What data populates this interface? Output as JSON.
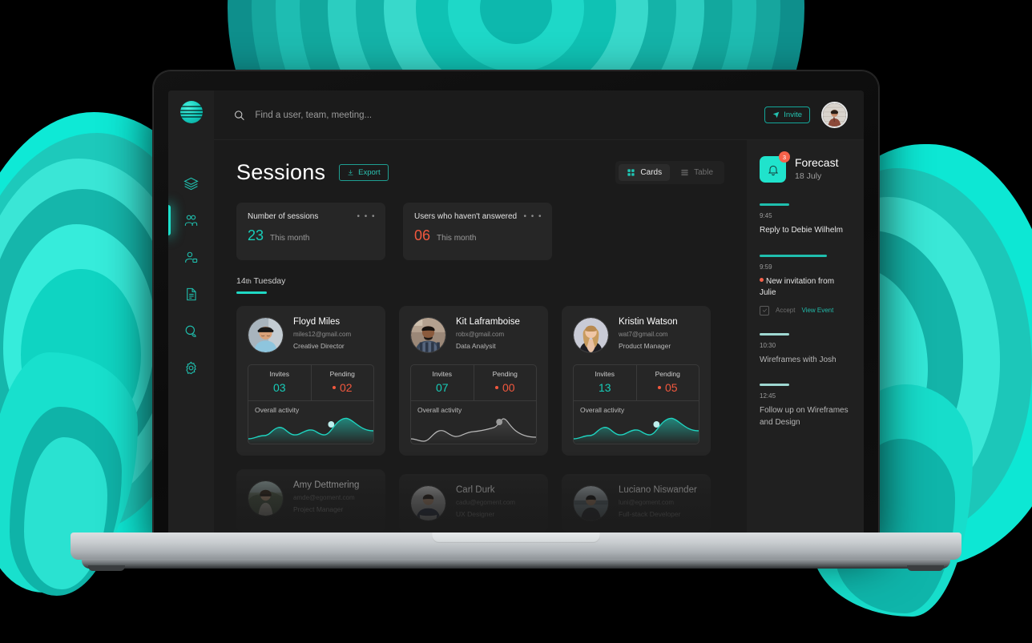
{
  "brand": {
    "accent": "#1ecfbc",
    "danger": "#f2583e",
    "logo_icon": "sphere-logo"
  },
  "sidebar": {
    "items": [
      {
        "icon": "layers-icon",
        "name": "layers",
        "active": false
      },
      {
        "icon": "people-icon",
        "name": "people",
        "active": true
      },
      {
        "icon": "user-add-icon",
        "name": "user-add",
        "active": false
      },
      {
        "icon": "document-icon",
        "name": "documents",
        "active": false
      },
      {
        "icon": "chat-icon",
        "name": "chat",
        "active": false
      },
      {
        "icon": "gear-icon",
        "name": "settings",
        "active": false
      }
    ]
  },
  "topbar": {
    "search_icon": "search-icon",
    "search_value": "",
    "search_placeholder": "Find a user, team, meeting...",
    "invite_label": "Invite",
    "invite_icon": "send-icon",
    "avatar": "user-avatar"
  },
  "page": {
    "title": "Sessions",
    "export_label": "Export",
    "export_icon": "download-icon",
    "view_toggle": {
      "cards_label": "Cards",
      "cards_icon": "grid-icon",
      "table_label": "Table",
      "table_icon": "rows-icon",
      "selected": "Cards"
    },
    "stats": [
      {
        "label": "Number of sessions",
        "value": "23",
        "sub": "This month",
        "color": "teal",
        "menu": "• • •"
      },
      {
        "label": "Users  who haven't answered",
        "value": "06",
        "sub": "This month",
        "color": "orange",
        "menu": "• • •"
      }
    ],
    "day_group": {
      "day": "14",
      "suffix": "th",
      "weekday": "Tuesday"
    },
    "metrics_headers": {
      "invites": "Invites",
      "pending": "Pending",
      "activity": "Overall activity"
    },
    "cards": [
      {
        "name": "Floyd Miles",
        "email": "miles12@gmail.com",
        "role": "Creative Director",
        "invites": "03",
        "pending": "02",
        "avatar": "avatar-floyd",
        "spark_color": "teal",
        "spark": [
          30,
          27,
          22,
          24,
          16,
          10,
          16,
          22,
          24,
          20,
          14,
          16,
          22,
          24,
          16,
          6,
          2,
          6,
          12,
          16,
          14
        ],
        "marker_index": 15
      },
      {
        "name": "Kit Laframboise",
        "email": "robx@gmail.com",
        "role": "Data Analysit",
        "invites": "07",
        "pending": "00",
        "avatar": "avatar-kit",
        "spark_color": "gray",
        "spark": [
          30,
          28,
          30,
          22,
          20,
          18,
          14,
          16,
          20,
          22,
          20,
          18,
          16,
          14,
          12,
          4,
          10,
          18,
          22,
          24,
          26
        ],
        "marker_index": 15
      },
      {
        "name": "Kristin Watson",
        "email": "wat7@gmail.com",
        "role": "Product Manager",
        "invites": "13",
        "pending": "05",
        "avatar": "avatar-kristin",
        "spark_color": "teal",
        "spark": [
          30,
          27,
          22,
          24,
          16,
          10,
          16,
          22,
          24,
          20,
          14,
          16,
          22,
          24,
          16,
          6,
          2,
          6,
          12,
          16,
          14
        ],
        "marker_index": 15
      }
    ],
    "cards_next_row": [
      {
        "name": "Amy Dettmering",
        "email": "amde@egoment.com",
        "role": "Project Manager",
        "avatar": "avatar-amy"
      },
      {
        "name": "Carl Durk",
        "email": "cadu@egoment.com",
        "role": "UX Designer",
        "avatar": "avatar-carl"
      },
      {
        "name": "Luciano Niswander",
        "email": "luni@egoment.com",
        "role": "Full-stack Developer",
        "avatar": "avatar-luciano"
      }
    ]
  },
  "forecast": {
    "title": "Forecast",
    "date": "18 July",
    "badge": "3",
    "bell_icon": "bell-icon",
    "events": [
      {
        "time": "9:45",
        "text": "Reply to Debie Wilhelm",
        "bar_width": "32%",
        "bar_color": "#1fbfae",
        "dim": false
      },
      {
        "time": "9:59",
        "text": "New invitation from Julie",
        "bar_width": "72%",
        "bar_color": "#1fbfae",
        "dim": false,
        "dot": true,
        "accept_label": "Accept",
        "view_label": "View Event",
        "check_icon": "check-icon"
      },
      {
        "time": "10:30",
        "text": "Wireframes with Josh",
        "bar_width": "32%",
        "bar_color": "#9fd8d2",
        "dim": true
      },
      {
        "time": "12:45",
        "text": "Follow up on Wireframes and Design",
        "bar_width": "32%",
        "bar_color": "#9fd8d2",
        "dim": true
      }
    ]
  }
}
